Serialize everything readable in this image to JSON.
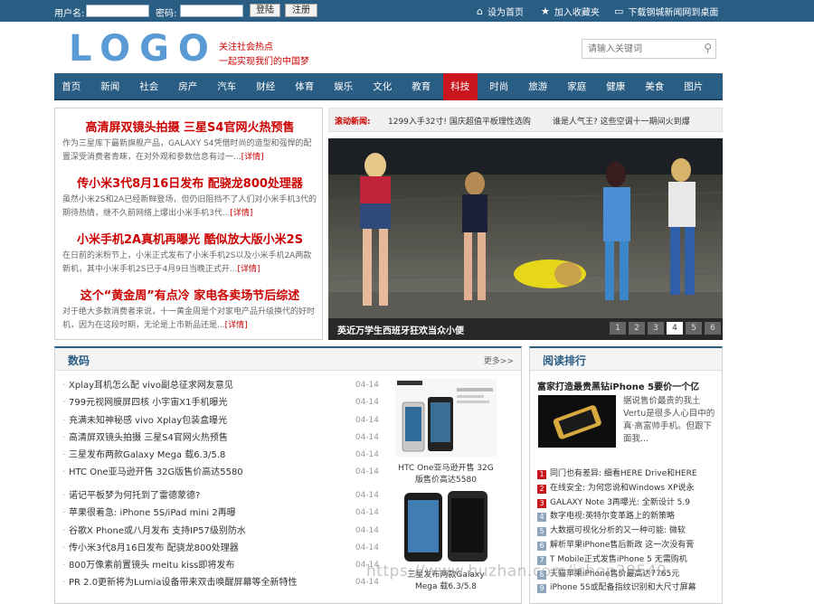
{
  "topbar": {
    "username_label": "用户名:",
    "password_label": "密码:",
    "login_label": "登陆",
    "register_label": "注册",
    "homepage_label": "设为首页",
    "favorite_label": "加入收藏夹",
    "download_label": "下载钢城新闻网到桌面"
  },
  "header": {
    "logo": "LOGO",
    "slogan1": "关注社会热点",
    "slogan2": "一起实现我们的中国梦",
    "search_placeholder": "请输入关键词"
  },
  "nav": [
    "首页",
    "新闻",
    "社会",
    "房产",
    "汽车",
    "财经",
    "体育",
    "娱乐",
    "文化",
    "教育",
    "科技",
    "时尚",
    "旅游",
    "家庭",
    "健康",
    "美食",
    "图片"
  ],
  "nav_active": "科技",
  "headlines": [
    {
      "title": "高清屏双镜头拍摄 三星S4官网火热预售",
      "text": "作为三星库下最新旗舰产品，GALAXY S4凭借时尚的造型和强悍的配置深受消费者青睐，在对外观和参数信息有过一...",
      "more": "[详情]"
    },
    {
      "title": "传小米3代8月16日发布 配骁龙800处理器",
      "text": "虽然小米2S和2A已经新鲜登场，但仍旧阻挡不了人们对小米手机3代的期待热情，继不久前网络上爆出小米手机3代...",
      "more": "[详情]"
    },
    {
      "title": "小米手机2A真机再曝光 酷似放大版小米2S",
      "text": "在日前的米粉节上，小米正式发布了小米手机2S以及小米手机2A两款新机，其中小米手机2S已于4月9日当晚正式开...",
      "more": "[详情]"
    },
    {
      "title": "这个“黄金周”有点冷 家电各卖场节后综述",
      "text": "对于绝大多数消费者来说，十一黄金周是个对家电产品升级换代的好时机，因为在这段时期，无论是上市新品还是...",
      "more": "[详情]"
    }
  ],
  "roll": {
    "label": "滚动新闻:",
    "items": [
      "1299入手32寸! 国庆超值平板理性选购",
      "谁是人气王? 这些空调十一期间火到爆"
    ]
  },
  "slider": {
    "caption": "英近万学生西班牙狂欢当众小便",
    "pages": [
      "1",
      "2",
      "3",
      "4",
      "5",
      "6"
    ],
    "active_page": "4"
  },
  "digital": {
    "title": "数码",
    "more": "更多>>",
    "list1": [
      {
        "t": "Xplay耳机怎么配 vivo副总征求网友意见",
        "d": "04-14"
      },
      {
        "t": "799元视网膜屏四核 小宇宙X1手机曝光",
        "d": "04-14"
      },
      {
        "t": "充满未知神秘感 vivo Xplay包装盒曝光",
        "d": "04-14"
      },
      {
        "t": "高清屏双镜头拍摄 三星S4官网火热预售",
        "d": "04-14"
      },
      {
        "t": "三星发布两款Galaxy Mega 载6.3/5.8",
        "d": "04-14"
      },
      {
        "t": "HTC One亚马逊开售 32G版售价高达5580",
        "d": "04-14"
      }
    ],
    "list2": [
      {
        "t": "诺记平板梦为何托到了雷德蒙德?",
        "d": "04-14"
      },
      {
        "t": "苹果很着急: iPhone 5S/iPad mini 2再曝",
        "d": "04-14"
      },
      {
        "t": "谷歌X Phone或八月发布 支持IP57级别防水",
        "d": "04-14"
      },
      {
        "t": "传小米3代8月16日发布 配骁龙800处理器",
        "d": "04-14"
      },
      {
        "t": "800万像素前置镜头 meitu kiss即将发布",
        "d": "04-14"
      },
      {
        "t": "PR 2.0更新将为Lumia设备带来双击唤醒屏幕等全新特性",
        "d": "04-14"
      }
    ],
    "thumb1_caption": "HTC One亚马逊开售 32G版售价高达5580",
    "thumb2_caption": "三星发布两款Galaxy Mega 载6.3/5.8"
  },
  "rank": {
    "title": "阅读排行",
    "feature_title": "富家打造最贵黑钻iPhone 5要价一个亿",
    "feature_desc": "据说售价最贵的我土Vertu是很多人心目中的真·高富帅手机。但跟下面我...",
    "items": [
      "同门也有差异: 细看HERE Drive和HERE",
      "在线安全: 为何您说和Windows XP说永",
      "GALAXY Note 3再曝光: 全新设计 5.9",
      "数字电视:英特尔变革路上的新策略",
      "大数据可视化分析的又一种可能: 微软",
      "解析苹果iPhone售后新政 这一次没有膏",
      "T Mobile正式发售iPhone 5 无需购机",
      "天猫苹果iPhone售价最高达7765元",
      "iPhone 5S或配备指纹识别和大尺寸屏幕"
    ]
  },
  "watermark": "https://www.huzhan.com/ishop39549"
}
